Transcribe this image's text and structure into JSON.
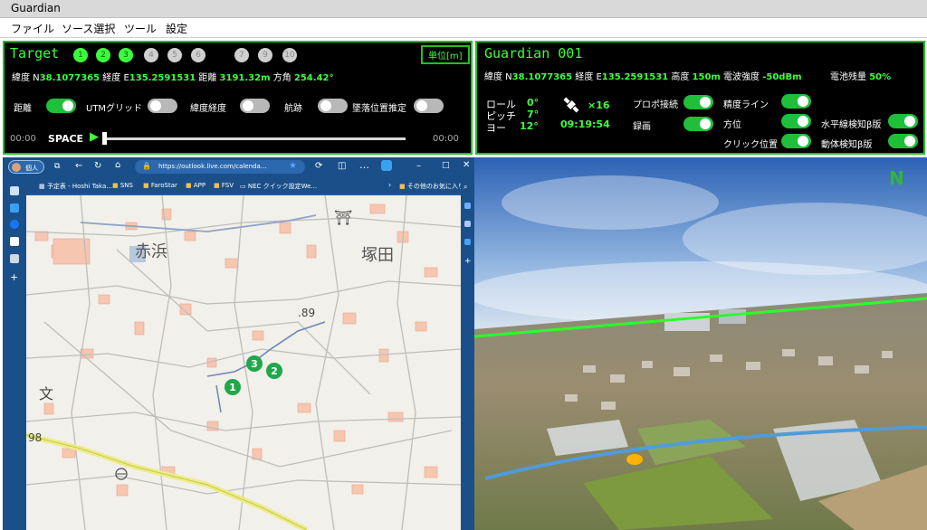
{
  "window": {
    "title": "Guardian"
  },
  "menu": [
    "ファイル",
    "ソース選択",
    "ツール",
    "設定"
  ],
  "target_panel": {
    "title": "Target",
    "targets": [
      {
        "num": "1",
        "active": true
      },
      {
        "num": "2",
        "active": true
      },
      {
        "num": "3",
        "active": true
      },
      {
        "num": "4",
        "active": false
      },
      {
        "num": "5",
        "active": false
      },
      {
        "num": "6",
        "active": false
      },
      {
        "num": "7",
        "active": false
      },
      {
        "num": "9",
        "active": false
      },
      {
        "num": "10",
        "active": false
      }
    ],
    "unit_button": "単位[m]",
    "lat_label": "緯度 N",
    "lat_value": "38.1077365",
    "lon_label": "経度 E",
    "lon_value": "135.2591531",
    "dist_label": "距離",
    "dist_value": "3191.32m",
    "dir_label": "方角",
    "dir_value": "254.42°",
    "toggles": [
      {
        "label": "距離",
        "on": true
      },
      {
        "label": "UTMグリッド",
        "on": false
      },
      {
        "label": "緯度経度",
        "on": false
      },
      {
        "label": "航跡",
        "on": false
      },
      {
        "label": "墜落位置推定",
        "on": false
      }
    ],
    "time_start": "00:00",
    "playback_label": "SPACE",
    "time_end": "00:00"
  },
  "guardian_panel": {
    "title": "Guardian 001",
    "lat_label": "緯度 N",
    "lat_value": "38.1077365",
    "lon_label": "経度 E",
    "lon_value": "135.2591531",
    "alt_label": "高度",
    "alt_value": "150m",
    "signal_label": "電波強度",
    "signal_value": "-50dBm",
    "battery_label": "電池残量",
    "battery_value": "50%",
    "roll_label": "ロール",
    "roll_value": "0°",
    "pitch_label": "ピッチ",
    "pitch_value": "7°",
    "yaw_label": "ヨー",
    "yaw_value": "12°",
    "satellite_count": "×16",
    "clock": "09:19:54",
    "toggles": [
      {
        "label": "プロポ接続",
        "on": true
      },
      {
        "label": "録画",
        "on": true
      },
      {
        "label": "精度ライン",
        "on": true
      },
      {
        "label": "方位",
        "on": true
      },
      {
        "label": "クリック位置",
        "on": true
      },
      {
        "label": "水平線検知β版",
        "on": true
      },
      {
        "label": "動体検知β版",
        "on": true
      }
    ]
  },
  "browser": {
    "profile": "個人",
    "url": "https://outlook.live.com/calenda...",
    "favorites": [
      "予定表 - Hoshi Taka...",
      "SNS",
      "FaroStar",
      "APP",
      "FSV",
      "NEC クイック設定We..."
    ],
    "other_favorites": "その他のお気に入り"
  },
  "map": {
    "labels": {
      "akahama": "赤浜",
      "tsukada": "塚田",
      "spot_89": ".89",
      "spot_98": "98"
    },
    "markers": [
      "1",
      "2",
      "3"
    ]
  },
  "camera": {
    "north_label": "N"
  },
  "colors": {
    "accent_green": "#3cff3c",
    "border_green": "#1ec31e",
    "toggle_on": "#1fbf3a"
  }
}
